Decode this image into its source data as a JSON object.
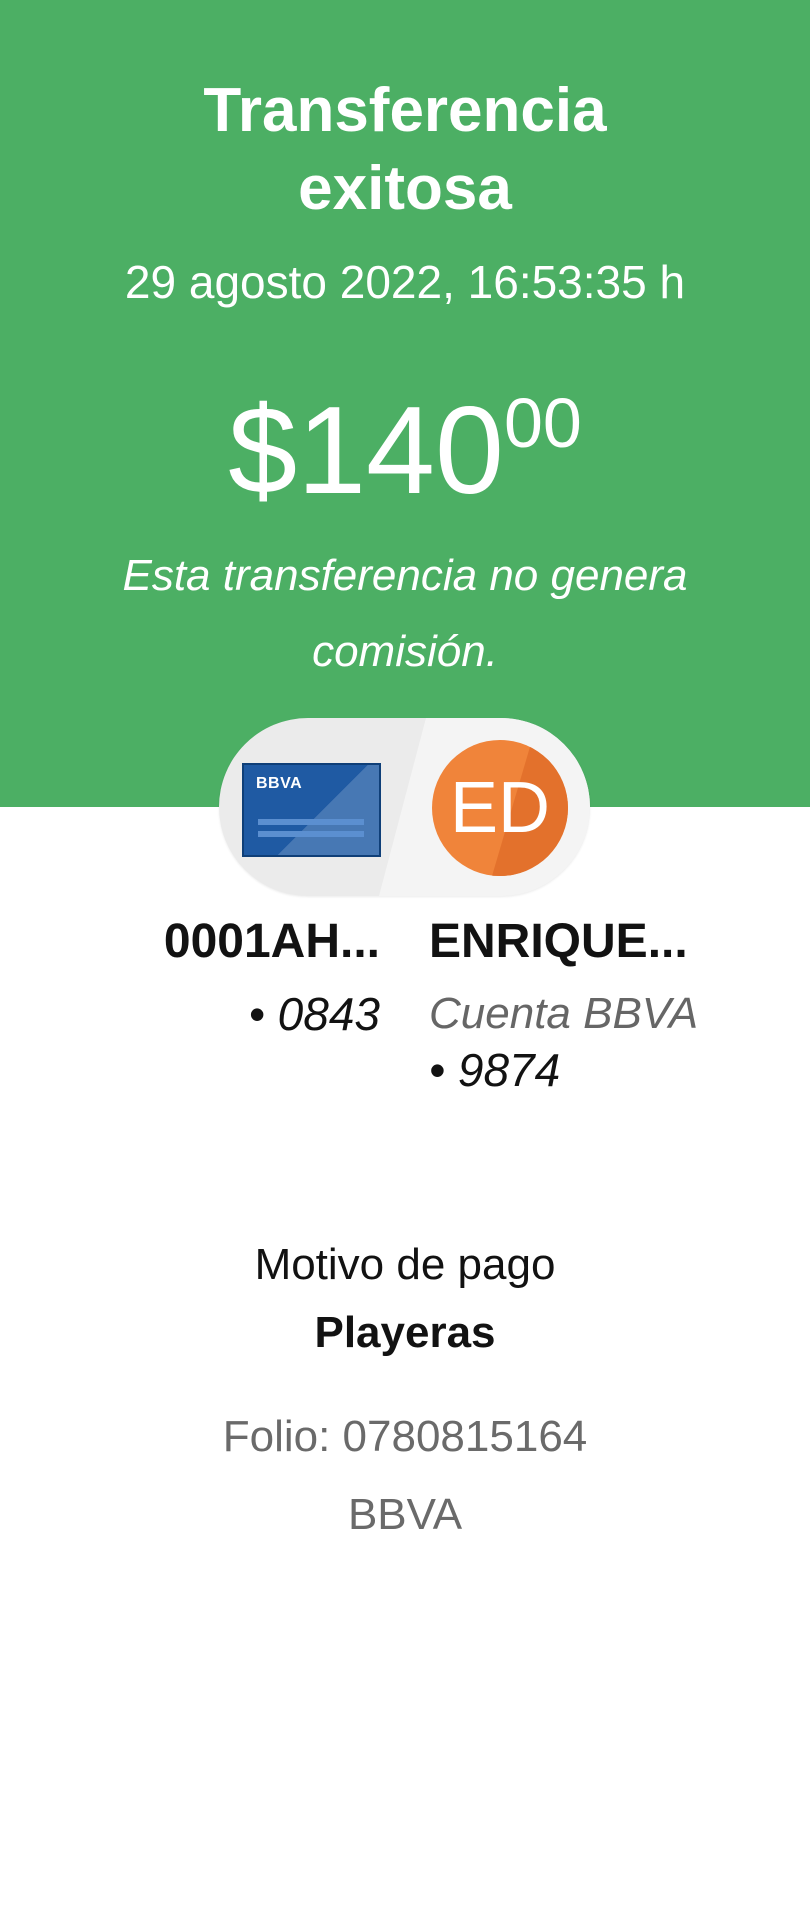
{
  "header": {
    "title_line1": "Transferencia",
    "title_line2": "exitosa",
    "datetime": "29 agosto 2022, 16:53:35 h",
    "amount_main": "$140",
    "amount_cents": "00",
    "commission_note": "Esta transferencia no genera comisión.",
    "background_color": "#4caf64"
  },
  "transfer_pill": {
    "origin_card_label": "BBVA",
    "origin_icon": "bank-card-icon",
    "destination_initials": "ED",
    "avatar_color": "#f0843a"
  },
  "origin": {
    "name": "0001AH...",
    "account": "• 0843"
  },
  "destination": {
    "name": "ENRIQUE...",
    "bank": "Cuenta BBVA",
    "account": "• 9874"
  },
  "details": {
    "motivo_label": "Motivo de pago",
    "motivo_value": "Playeras",
    "folio": "Folio: 0780815164",
    "bank": "BBVA"
  }
}
